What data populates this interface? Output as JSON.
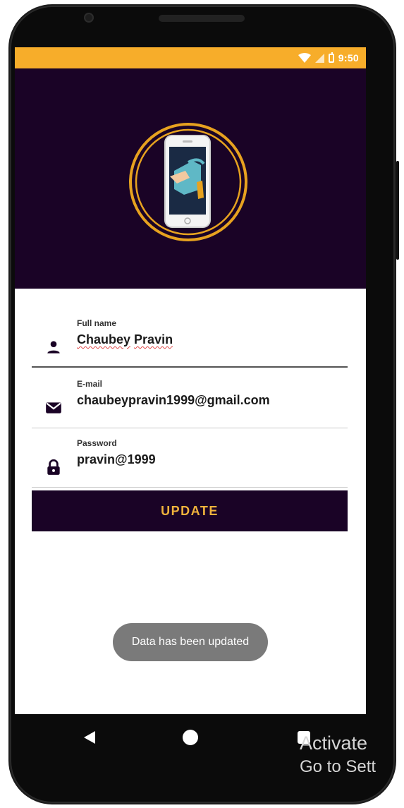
{
  "status_bar": {
    "time": "9:50",
    "background": "#f7ad2a"
  },
  "header": {
    "background": "#1a0326",
    "logo_icon": "phone-in-hand-logo"
  },
  "form": {
    "fields": [
      {
        "label": "Full name",
        "value_parts": [
          "Chaubey",
          "Pravin"
        ],
        "icon": "person-icon"
      },
      {
        "label": "E-mail",
        "value": "chaubeypravin1999@gmail.com",
        "icon": "mail-icon"
      },
      {
        "label": "Password",
        "value": "pravin@1999",
        "icon": "lock-icon"
      }
    ],
    "update_button": "UPDATE",
    "accent_color": "#f0b23c"
  },
  "toast": {
    "message": "Data has been updated"
  },
  "navigation": {
    "back": "back-icon",
    "home": "home-icon",
    "recents": "recents-icon"
  },
  "watermark": {
    "line1": "Activate",
    "line2": "Go to Sett"
  }
}
